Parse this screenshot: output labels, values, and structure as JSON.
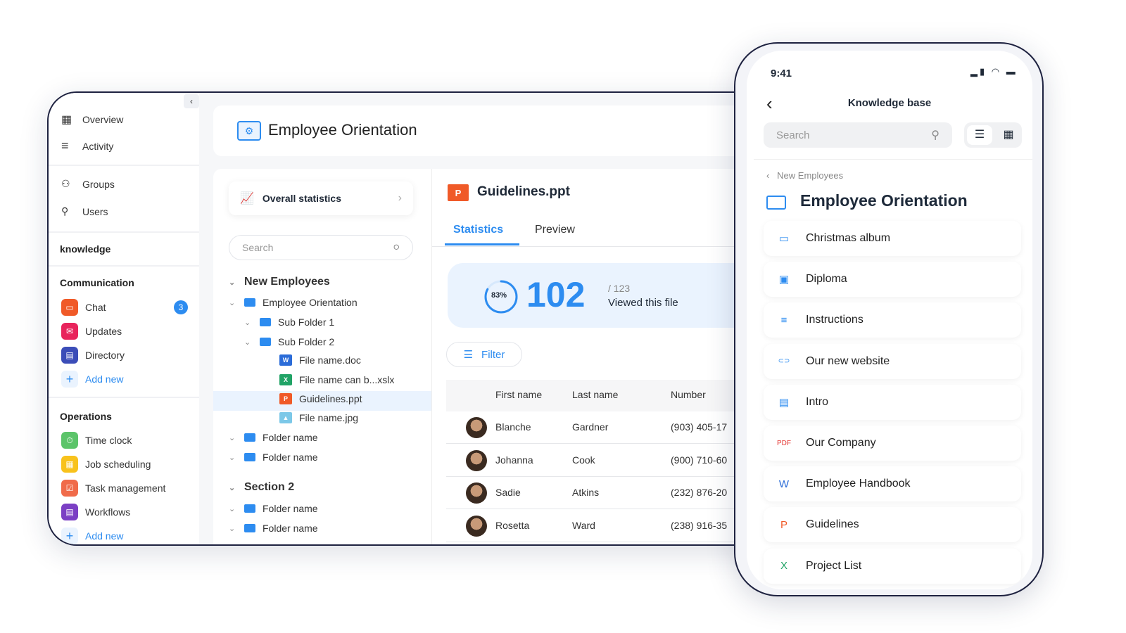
{
  "sidebar": {
    "items": [
      {
        "label": "Overview",
        "icon": "grid-icon"
      },
      {
        "label": "Activity",
        "icon": "lines-icon"
      },
      {
        "label": "Groups",
        "icon": "groups-icon"
      },
      {
        "label": "Users",
        "icon": "user-icon"
      }
    ],
    "knowledge": "knowledge",
    "communication": {
      "title": "Communication",
      "items": [
        {
          "label": "Chat",
          "color": "#f05a28",
          "badge": "3"
        },
        {
          "label": "Updates",
          "color": "#e8245c"
        },
        {
          "label": "Directory",
          "color": "#3b4db8"
        }
      ],
      "add": "Add new"
    },
    "operations": {
      "title": "Operations",
      "items": [
        {
          "label": "Time clock",
          "color": "#5cc46a"
        },
        {
          "label": "Job scheduling",
          "color": "#f8c21c"
        },
        {
          "label": "Task management",
          "color": "#f06b4a"
        },
        {
          "label": "Workflows",
          "color": "#7b3fc4"
        }
      ],
      "add": "Add new"
    }
  },
  "header": {
    "title": "Employee Orientation"
  },
  "tree": {
    "stats": "Overall statistics",
    "search_placeholder": "Search",
    "section1": "New Employees",
    "nodes": [
      "Employee Orientation",
      "Sub Folder 1",
      "Sub Folder 2",
      "File name.doc",
      "File name can b...xslx",
      "Guidelines.ppt",
      "File name.jpg",
      "Folder name",
      "Folder name"
    ],
    "section2": "Section 2",
    "nodes2": [
      "Folder name",
      "Folder name"
    ]
  },
  "detail": {
    "file": "Guidelines.ppt",
    "tabs": [
      "Statistics",
      "Preview"
    ],
    "percent": "83%",
    "percent_value": 83,
    "count": "102",
    "total": "/ 123",
    "viewed": "Viewed this file",
    "filter": "Filter",
    "columns": [
      "First name",
      "Last name",
      "Number"
    ],
    "rows": [
      [
        "Blanche",
        "Gardner",
        "(903) 405-17"
      ],
      [
        "Johanna",
        "Cook",
        "(900) 710-60"
      ],
      [
        "Sadie",
        "Atkins",
        "(232) 876-20"
      ],
      [
        "Rosetta",
        "Ward",
        "(238) 916-35"
      ]
    ]
  },
  "phone": {
    "time": "9:41",
    "title": "Knowledge base",
    "search_placeholder": "Search",
    "breadcrumb": "New Employees",
    "folder": "Employee Orientation",
    "items": [
      {
        "label": "Christmas album",
        "icon": "folder-icon",
        "glyph": "▭",
        "color": "#2d8cf0"
      },
      {
        "label": "Diploma",
        "icon": "image-icon",
        "glyph": "▣",
        "color": "#2d8cf0"
      },
      {
        "label": "Instructions",
        "icon": "text-lines-icon",
        "glyph": "≡",
        "color": "#2d8cf0"
      },
      {
        "label": "Our new website",
        "icon": "link-icon",
        "glyph": "⊂⊃",
        "color": "#2d8cf0"
      },
      {
        "label": "Intro",
        "icon": "video-icon",
        "glyph": "▤",
        "color": "#2d8cf0"
      },
      {
        "label": "Our Company",
        "icon": "pdf-icon",
        "glyph": "PDF",
        "color": "#e53935"
      },
      {
        "label": "Employee Handbook",
        "icon": "word-icon",
        "glyph": "W",
        "color": "#2b6cd8"
      },
      {
        "label": "Guidelines",
        "icon": "powerpoint-icon",
        "glyph": "P",
        "color": "#f05a28"
      },
      {
        "label": "Project List",
        "icon": "excel-icon",
        "glyph": "X",
        "color": "#21a366"
      }
    ]
  }
}
